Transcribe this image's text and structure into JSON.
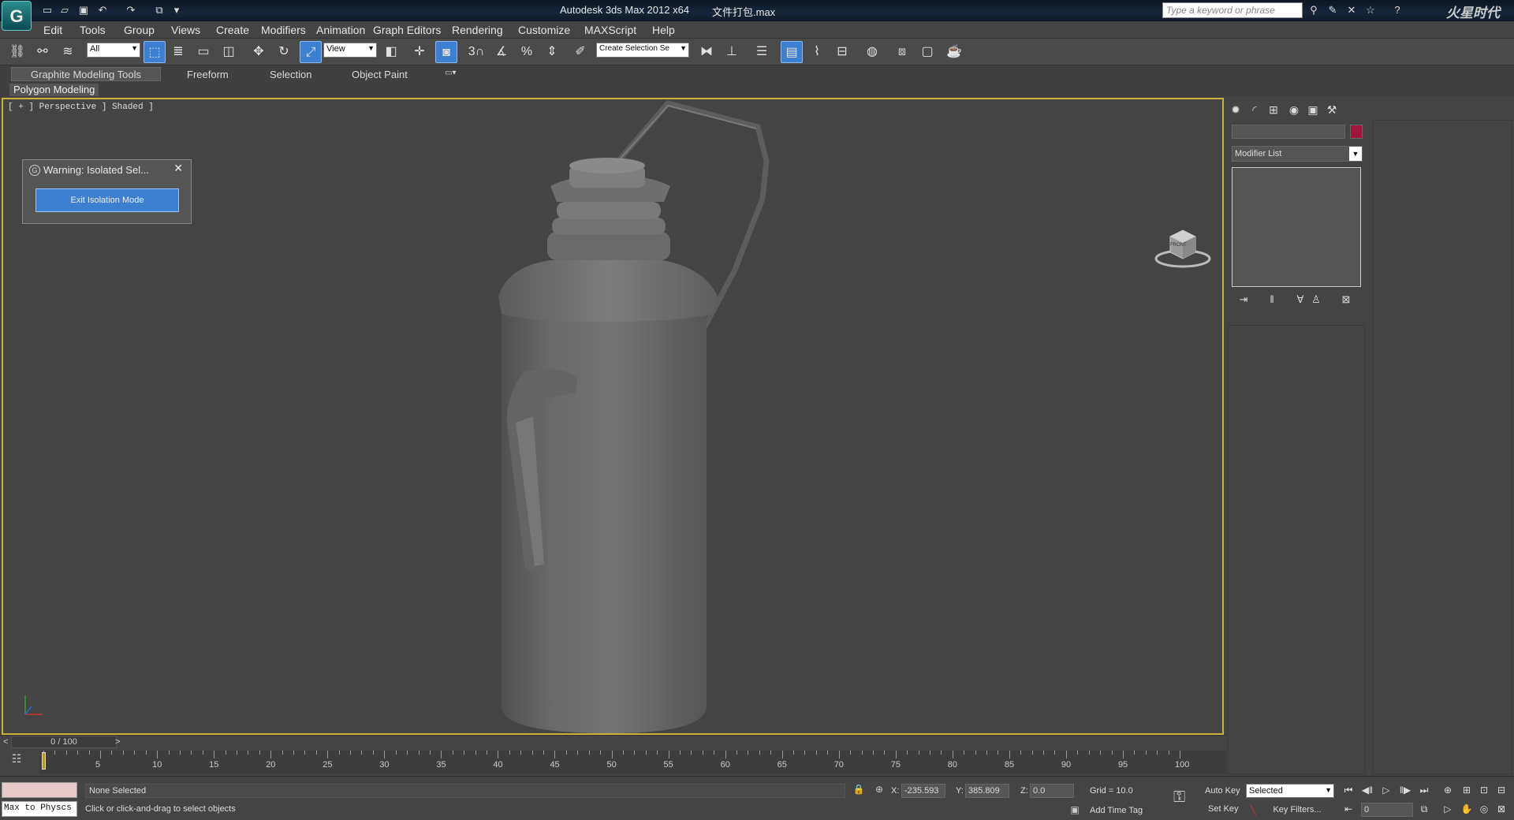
{
  "window": {
    "logo": "G",
    "title": "Autodesk 3ds Max  2012 x64",
    "file": "文件打包.max",
    "search_placeholder": "Type a keyword or phrase",
    "brand": "火星时代"
  },
  "menu": [
    "Edit",
    "Tools",
    "Group",
    "Views",
    "Create",
    "Modifiers",
    "Animation",
    "Graph Editors",
    "Rendering",
    "Customize",
    "MAXScript",
    "Help"
  ],
  "toolbar": {
    "filter_value": "All",
    "refcoord_value": "View",
    "named_selection_placeholder": "Create Selection Se",
    "snap_label": "3"
  },
  "ribbon": {
    "tabs": [
      "Graphite Modeling Tools",
      "Freeform",
      "Selection",
      "Object Paint"
    ],
    "panel": "Polygon Modeling"
  },
  "viewport": {
    "label": "[ + ] Perspective ] Shaded ]",
    "background": "#444444",
    "border_color": "#c9b33f"
  },
  "dialog": {
    "title": "Warning: Isolated Sel...",
    "close": "✕",
    "button": "Exit Isolation Mode",
    "icon": "G"
  },
  "viewcube": {
    "face": "FRONT"
  },
  "command_panel": {
    "modifier_list": "Modifier List",
    "color_swatch": "#a0163a"
  },
  "timeline": {
    "slider_text": "0 / 100",
    "prev": "<",
    "next": ">",
    "ticks": [
      "5",
      "10",
      "15",
      "20",
      "25",
      "30",
      "35",
      "40",
      "45",
      "50",
      "55",
      "60",
      "65",
      "70",
      "75",
      "80",
      "85",
      "90",
      "95",
      "100"
    ]
  },
  "status": {
    "maxscript": "Max to Physcs (",
    "selection": "None Selected",
    "prompt": "Click or click-and-drag to select objects",
    "x_label": "X:",
    "x_value": "-235.593",
    "y_label": "Y:",
    "y_value": "385.809",
    "z_label": "Z:",
    "z_value": "0.0",
    "grid": "Grid = 10.0",
    "add_time_tag": "Add Time Tag",
    "auto_key": "Auto Key",
    "set_key": "Set Key",
    "selected_value": "Selected",
    "key_filters": "Key Filters...",
    "frame_value": "0"
  }
}
